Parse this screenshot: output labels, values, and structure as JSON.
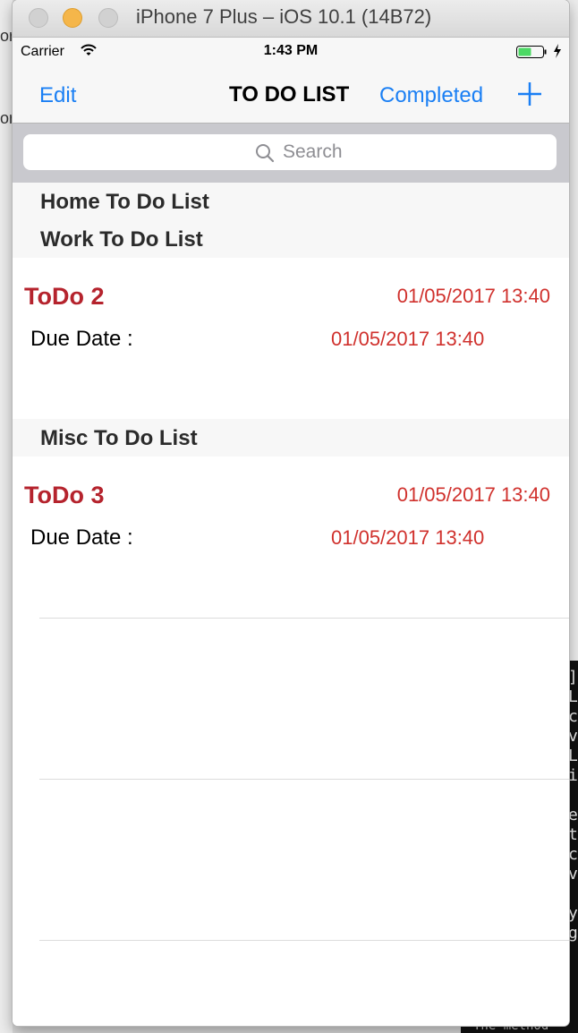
{
  "window": {
    "title": "iPhone 7 Plus – iOS 10.1 (14B72)"
  },
  "status_bar": {
    "carrier": "Carrier",
    "time": "1:43 PM"
  },
  "nav": {
    "left_label": "Edit",
    "title": "TO DO LIST",
    "completed_label": "Completed",
    "add_icon": "plus-icon"
  },
  "search": {
    "placeholder": "Search"
  },
  "sections": [
    {
      "header": "Home To Do List",
      "items": []
    },
    {
      "header": "Work To Do List",
      "items": [
        {
          "title": "ToDo 2",
          "date": "01/05/2017 13:40",
          "due_label": "Due Date :",
          "due_value": "01/05/2017 13:40"
        }
      ]
    },
    {
      "header": "Misc To Do List",
      "items": [
        {
          "title": "ToDo 3",
          "date": "01/05/2017 13:40",
          "due_label": "Due Date :",
          "due_value": "01/05/2017 13:40"
        }
      ]
    }
  ],
  "colors": {
    "tint": "#1a7ff4",
    "todo_title": "#b5232d",
    "date": "#d0312d",
    "section_bg": "#f7f7f7",
    "search_bar_bg": "#c9c9ce"
  },
  "background": {
    "left_fragments": [
      "or",
      "or"
    ],
    "terminal_chars": "]\nL\nc\nv\nL\ni\n\ne\nt\nc\nv\n\ny\ng",
    "bottom_terminal": "The method"
  }
}
